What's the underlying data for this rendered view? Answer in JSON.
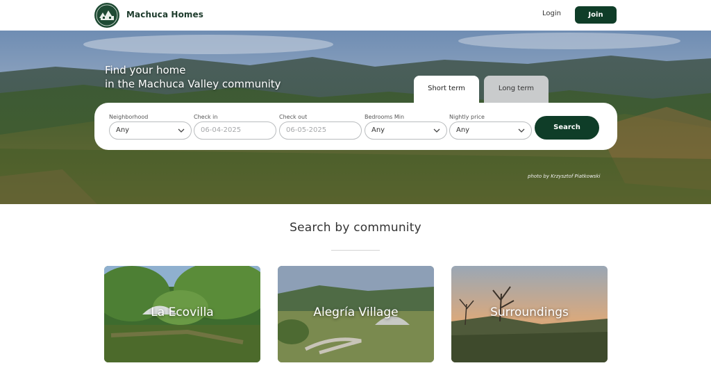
{
  "header": {
    "brand": "Machuca Homes",
    "login_label": "Login",
    "join_label": "Join"
  },
  "hero": {
    "title_line1": "Find your home",
    "title_line2": "in the Machuca Valley community",
    "tabs": [
      {
        "label": "Short term",
        "active": true
      },
      {
        "label": "Long term",
        "active": false
      }
    ],
    "search": {
      "neighborhood": {
        "label": "Neighborhood",
        "value": "Any"
      },
      "check_in": {
        "label": "Check in",
        "placeholder": "06-04-2025"
      },
      "check_out": {
        "label": "Check out",
        "placeholder": "06-05-2025"
      },
      "bedrooms": {
        "label": "Bedrooms Min",
        "value": "Any"
      },
      "nightly_price": {
        "label": "Nightly price",
        "value": "Any"
      },
      "button_label": "Search"
    },
    "photo_credit": "photo by Krzysztof Piatkowski"
  },
  "community": {
    "title": "Search by community",
    "cards": [
      {
        "label": "La Ecovilla"
      },
      {
        "label": "Alegría Village"
      },
      {
        "label": "Surroundings"
      }
    ]
  },
  "colors": {
    "brand_green": "#0f3d28",
    "logo_green": "#1e4a33"
  },
  "icons": [
    "logo-house-icon",
    "chevron-down-icon"
  ]
}
